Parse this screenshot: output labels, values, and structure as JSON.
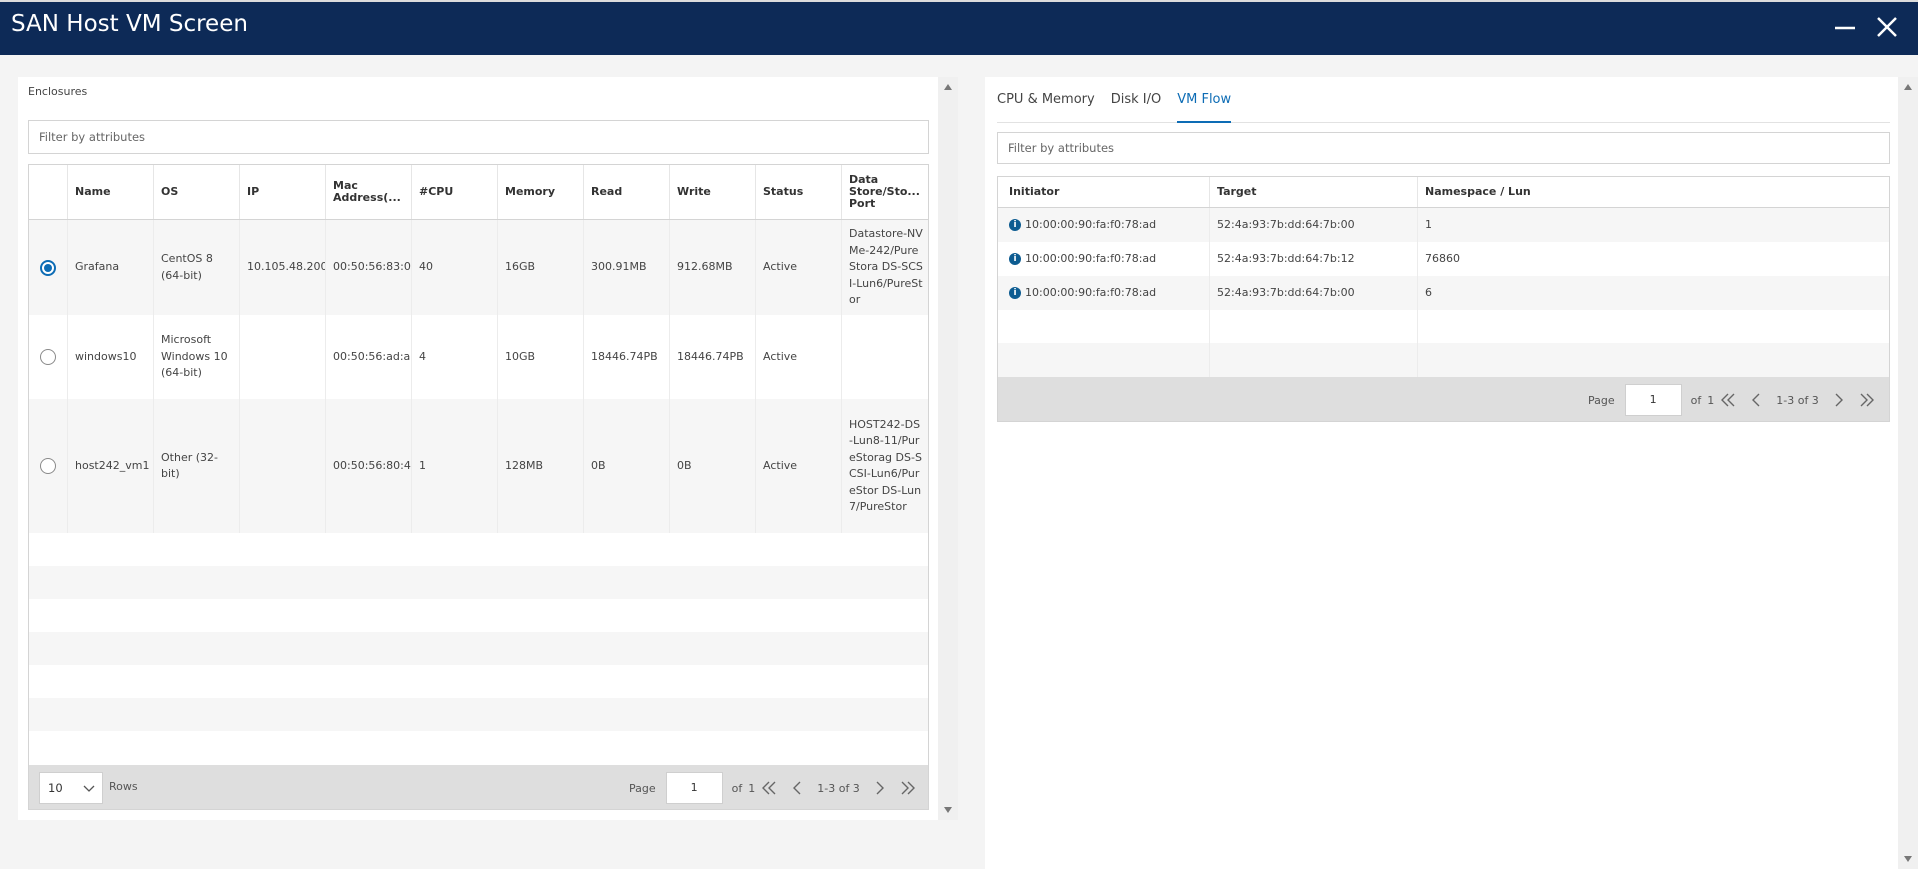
{
  "window": {
    "title": "SAN Host VM Screen",
    "minimize_icon": "minimize-icon",
    "close_icon": "close-icon"
  },
  "left": {
    "section_label": "Enclosures",
    "filter_placeholder": "Filter by attributes",
    "columns": [
      "",
      "Name",
      "OS",
      "IP",
      "Mac Address(...",
      "#CPU",
      "Memory",
      "Read",
      "Write",
      "Status",
      "Data Store/Sto... Port"
    ],
    "rows": [
      {
        "selected": true,
        "name": "Grafana",
        "os": "CentOS 8 (64-bit)",
        "ip": "10.105.48.200",
        "mac": "00:50:56:83:0",
        "cpu": "40",
        "memory": "16GB",
        "read": "300.91MB",
        "write": "912.68MB",
        "status": "Active",
        "datastore": "Datastore-NVMe-242/PureStora DS-SCSI-Lun6/PureStor"
      },
      {
        "selected": false,
        "name": "windows10",
        "os": "Microsoft Windows 10 (64-bit)",
        "ip": "",
        "mac": "00:50:56:ad:a",
        "cpu": "4",
        "memory": "10GB",
        "read": "18446.74PB",
        "write": "18446.74PB",
        "status": "Active",
        "datastore": ""
      },
      {
        "selected": false,
        "name": "host242_vm1",
        "os": "Other (32-bit)",
        "ip": "",
        "mac": "00:50:56:80:4",
        "cpu": "1",
        "memory": "128MB",
        "read": "0B",
        "write": "0B",
        "status": "Active",
        "datastore": "HOST242-DS-Lun8-11/PureStorag DS-SCSI-Lun6/PureStor DS-Lun7/PureStor"
      }
    ],
    "footer": {
      "rows_value": "10",
      "rows_label": "Rows",
      "page_label": "Page",
      "page_value": "1",
      "of_label": "of",
      "total_pages": "1",
      "range": "1-3 of 3"
    }
  },
  "right": {
    "tabs": [
      {
        "label": "CPU & Memory",
        "active": false
      },
      {
        "label": "Disk I/O",
        "active": false
      },
      {
        "label": "VM Flow",
        "active": true
      }
    ],
    "filter_placeholder": "Filter by attributes",
    "columns": [
      "Initiator",
      "Target",
      "Namespace / Lun"
    ],
    "rows": [
      {
        "initiator": "10:00:00:90:fa:f0:78:ad",
        "target": "52:4a:93:7b:dd:64:7b:00",
        "lun": "1"
      },
      {
        "initiator": "10:00:00:90:fa:f0:78:ad",
        "target": "52:4a:93:7b:dd:64:7b:12",
        "lun": "76860"
      },
      {
        "initiator": "10:00:00:90:fa:f0:78:ad",
        "target": "52:4a:93:7b:dd:64:7b:00",
        "lun": "6"
      }
    ],
    "footer": {
      "page_label": "Page",
      "page_value": "1",
      "of_label": "of",
      "total_pages": "1",
      "range": "1-3 of 3"
    }
  },
  "colors": {
    "titlebar": "#0d2a57",
    "accent": "#0d6cb5",
    "info": "#0d5c91"
  }
}
